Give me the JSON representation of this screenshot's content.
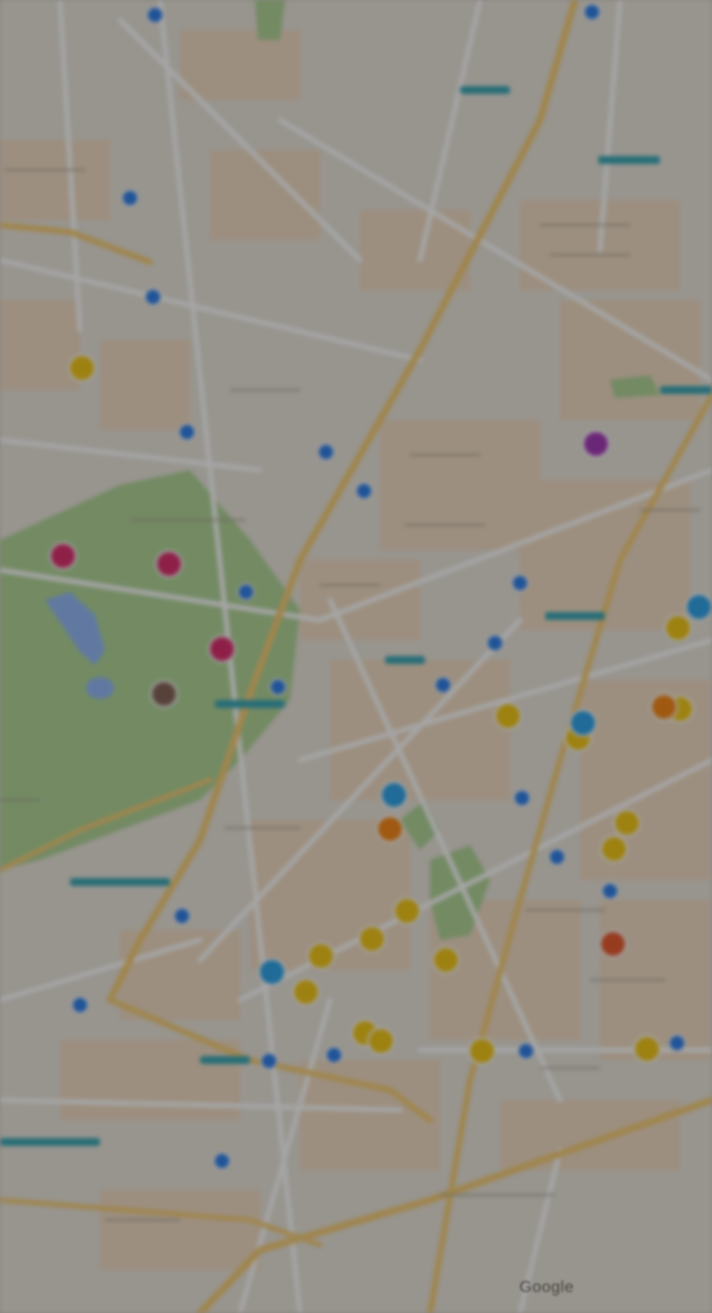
{
  "map": {
    "attribution": "Google",
    "colors": {
      "land": "#e8e3d8",
      "block": "#f0d9be",
      "park": "#a9d18e",
      "water": "#8ab4f8",
      "road": "#ffffff",
      "highway": "#f5c96a",
      "transit_marker": "#1a73e8",
      "overlay": "rgba(40,40,40,0.42)"
    },
    "markers": [
      {
        "category": "transit",
        "color": "#1a73e8"
      },
      {
        "category": "transit",
        "color": "#1a73e8"
      },
      {
        "category": "transit",
        "color": "#1a73e8"
      },
      {
        "category": "transit",
        "color": "#1a73e8"
      },
      {
        "category": "transit",
        "color": "#1a73e8"
      },
      {
        "category": "transit",
        "color": "#1a73e8"
      },
      {
        "category": "transit",
        "color": "#1a73e8"
      },
      {
        "category": "transit",
        "color": "#1a73e8"
      },
      {
        "category": "transit",
        "color": "#1a73e8"
      },
      {
        "category": "transit",
        "color": "#1a73e8"
      },
      {
        "category": "transit",
        "color": "#1a73e8"
      },
      {
        "category": "transit",
        "color": "#1a73e8"
      },
      {
        "category": "transit",
        "color": "#1a73e8"
      },
      {
        "category": "transit",
        "color": "#1a73e8"
      },
      {
        "category": "transit",
        "color": "#1a73e8"
      },
      {
        "category": "transit",
        "color": "#1a73e8"
      },
      {
        "category": "transit",
        "color": "#1a73e8"
      },
      {
        "category": "transit",
        "color": "#1a73e8"
      },
      {
        "category": "transit",
        "color": "#1a73e8"
      },
      {
        "category": "transit",
        "color": "#1a73e8"
      },
      {
        "category": "transit",
        "color": "#1a73e8"
      },
      {
        "category": "transit",
        "color": "#1a73e8"
      },
      {
        "category": "place",
        "color": "#f2c200"
      },
      {
        "category": "place",
        "color": "#f2c200"
      },
      {
        "category": "place",
        "color": "#f2c200"
      },
      {
        "category": "place",
        "color": "#f2c200"
      },
      {
        "category": "place",
        "color": "#f2c200"
      },
      {
        "category": "place",
        "color": "#f2c200"
      },
      {
        "category": "place",
        "color": "#f2c200"
      },
      {
        "category": "place",
        "color": "#f2c200"
      },
      {
        "category": "place",
        "color": "#f2c200"
      },
      {
        "category": "place",
        "color": "#f2c200"
      },
      {
        "category": "place",
        "color": "#f2c200"
      },
      {
        "category": "place",
        "color": "#f2c200"
      },
      {
        "category": "place",
        "color": "#f2c200"
      },
      {
        "category": "place",
        "color": "#f2c200"
      },
      {
        "category": "place",
        "color": "#f2c200"
      },
      {
        "category": "place",
        "color": "#f2c200"
      },
      {
        "category": "place",
        "color": "#1a9be8"
      },
      {
        "category": "place",
        "color": "#1a9be8"
      },
      {
        "category": "place",
        "color": "#1a9be8"
      },
      {
        "category": "place",
        "color": "#1a9be8"
      },
      {
        "category": "place",
        "color": "#f57c00"
      },
      {
        "category": "place",
        "color": "#f57c00"
      },
      {
        "category": "place",
        "color": "#e64a19"
      },
      {
        "category": "place",
        "color": "#d81b60"
      },
      {
        "category": "place",
        "color": "#d81b60"
      },
      {
        "category": "place",
        "color": "#d81b60"
      },
      {
        "category": "place",
        "color": "#795548"
      },
      {
        "category": "place",
        "color": "#9c27b0"
      }
    ]
  }
}
